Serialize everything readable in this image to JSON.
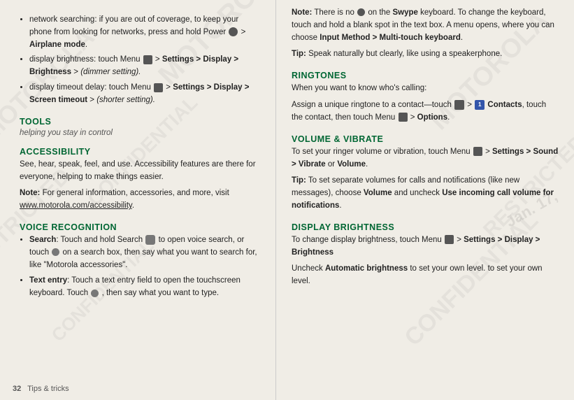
{
  "page": {
    "number": "32",
    "footer_label": "Tips & tricks"
  },
  "left": {
    "intro_bullets": [
      {
        "text_parts": [
          {
            "text": "network searching: if you are out of coverage, to keep your phone from looking for networks, press and hold Power ",
            "bold": false
          },
          {
            "text": "",
            "icon": "power-round-icon"
          },
          {
            "text": " > ",
            "bold": false
          },
          {
            "text": "Airplane mode",
            "bold": true
          }
        ]
      },
      {
        "text_parts": [
          {
            "text": "display brightness: touch Menu ",
            "bold": false
          },
          {
            "text": "",
            "icon": "menu-icon"
          },
          {
            "text": " > ",
            "bold": false
          },
          {
            "text": "Settings > Display > Brightness",
            "bold": true
          },
          {
            "text": " > ",
            "bold": false
          },
          {
            "text": "(dimmer setting).",
            "italic": true
          }
        ]
      },
      {
        "text_parts": [
          {
            "text": "display timeout delay: touch Menu ",
            "bold": false
          },
          {
            "text": "",
            "icon": "menu-icon"
          },
          {
            "text": " > ",
            "bold": false
          },
          {
            "text": "Settings > Display > Screen timeout",
            "bold": true
          },
          {
            "text": " > ",
            "bold": false
          },
          {
            "text": "(shorter setting).",
            "italic": true
          }
        ]
      }
    ],
    "tools_heading": "TOOLS",
    "tools_subheading": "helping you stay in control",
    "accessibility_heading": "ACCESSIBILITY",
    "accessibility_body": "See, hear, speak, feel, and use. Accessibility features are there for everyone, helping to make things easier.",
    "accessibility_note_label": "Note:",
    "accessibility_note_body": "For general information, accessories, and more, visit ",
    "accessibility_note_url": "www.motorola.com/accessibility",
    "accessibility_note_end": ".",
    "voice_heading": "VOICE RECOGNITION",
    "voice_bullets": [
      {
        "label": "Search",
        "label_colon": ":",
        "text": " Touch and hold Search ",
        "icon": "search-icon",
        "text2": " to open voice search, or touch ",
        "icon2": "mic-icon",
        "text3": " on a search box, then say what you want to search for, like \"Motorola accessories\"."
      },
      {
        "label": "Text entry",
        "label_colon": ":",
        "text": " Touch a text entry field to open the touchscreen keyboard. Touch ",
        "icon": "mic-icon",
        "text2": ", then say what you want to type."
      }
    ]
  },
  "right": {
    "note_label": "Note:",
    "note_body": " There is no ",
    "note_icon": "mic-icon",
    "note_body2": " on the ",
    "note_swype": "Swype",
    "note_body3": " keyboard. To change the keyboard, touch and hold a blank spot in the text box. A menu opens, where you can choose ",
    "note_bold_path": "Input Method > Multi-touch keyboard",
    "note_end": ".",
    "tip_label": "Tip:",
    "tip_body": " Speak naturally but clearly, like using a speakerphone.",
    "ringtones_heading": "RINGTONES",
    "ringtones_body": "When you want to know who's calling:",
    "ringtones_body2_pre": "Assign a unique ringtone to a contact—touch ",
    "ringtones_icon": "menu-round-icon",
    "ringtones_body2_mid": " > ",
    "ringtones_contacts_icon": "contacts-icon",
    "ringtones_contacts_label": "Contacts",
    "ringtones_body2_end": ", touch the contact, then touch Menu ",
    "ringtones_menu_icon": "menu-icon",
    "ringtones_options": " > Options.",
    "volume_heading": "VOLUME & VIBRATE",
    "volume_body_pre": "To set your ringer volume or vibration, touch Menu ",
    "volume_menu_icon": "menu-icon",
    "volume_body_mid": " > Settings > Sound > Vibrate or Volume.",
    "volume_vibrate_bold": "Settings > Sound > Vibrate",
    "volume_or": " or ",
    "volume_volume_bold": "Volume",
    "volume_tip_label": "Tip:",
    "volume_tip_body": " To set separate volumes for calls and notifications (like new messages), choose ",
    "volume_tip_bold": "Volume",
    "volume_tip_end": " and uncheck ",
    "volume_tip_uncheck_bold": "Use incoming call volume for notifications",
    "volume_tip_period": ".",
    "display_heading": "DISPLAY BRIGHTNESS",
    "display_body_pre": "To change display brightness, touch Menu ",
    "display_menu_icon": "menu-icon",
    "display_body_bold": "Settings > Display > Brightness",
    "display_body_end": "",
    "display_body2_pre": "Uncheck ",
    "display_body2_bold": "Automatic brightness",
    "display_body2_end": " to set your own level."
  },
  "date_stamp": "Jan. 17,"
}
